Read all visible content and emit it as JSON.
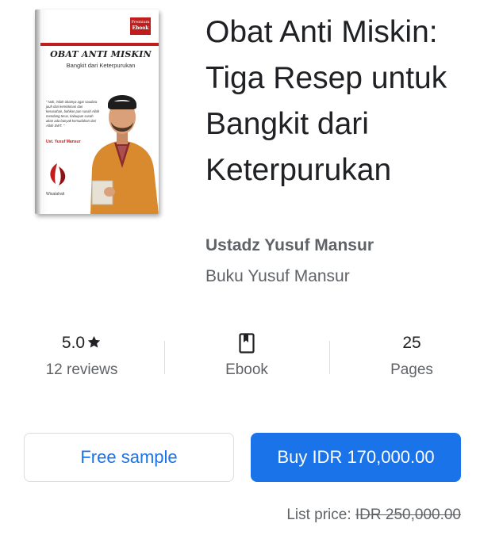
{
  "book": {
    "title": "Obat Anti Miskin: Tiga Resep untuk Bangkit dari Keterpurukan",
    "author": "Ustadz Yusuf Mansur",
    "series": "Buku Yusuf Mansur"
  },
  "cover": {
    "badge_line1": "Premium",
    "badge_line2": "Ebook",
    "title": "OBAT ANTI MISKIN",
    "subtitle": "Bangkit dari Keterpurukan",
    "quote": "\" Nah, inilah obatnya agar saudara jauh dari kemiskinan dan kesusahan, bahkan pun susah Allah mendang terus, kalaupun susah akan ada banyak kemudahan dari Allah SWT. \"",
    "author": "Ust. Yusuf Mansur",
    "publisher": "Wisatahati",
    "colors": {
      "accent": "#c21d1d",
      "robe": "#d98a2e"
    }
  },
  "stats": {
    "rating": "5.0",
    "rating_icon": "star-icon",
    "reviews": "12 reviews",
    "format_icon": "bookmark-book-icon",
    "format": "Ebook",
    "pages_count": "25",
    "pages_label": "Pages"
  },
  "actions": {
    "sample_label": "Free sample",
    "buy_label": "Buy IDR 170,000.00"
  },
  "list_price": {
    "label": "List price:",
    "value": "IDR 250,000.00"
  },
  "colors": {
    "primary": "#1a73e8",
    "text": "#202124",
    "secondary_text": "#5f6368",
    "divider": "#dadce0"
  }
}
